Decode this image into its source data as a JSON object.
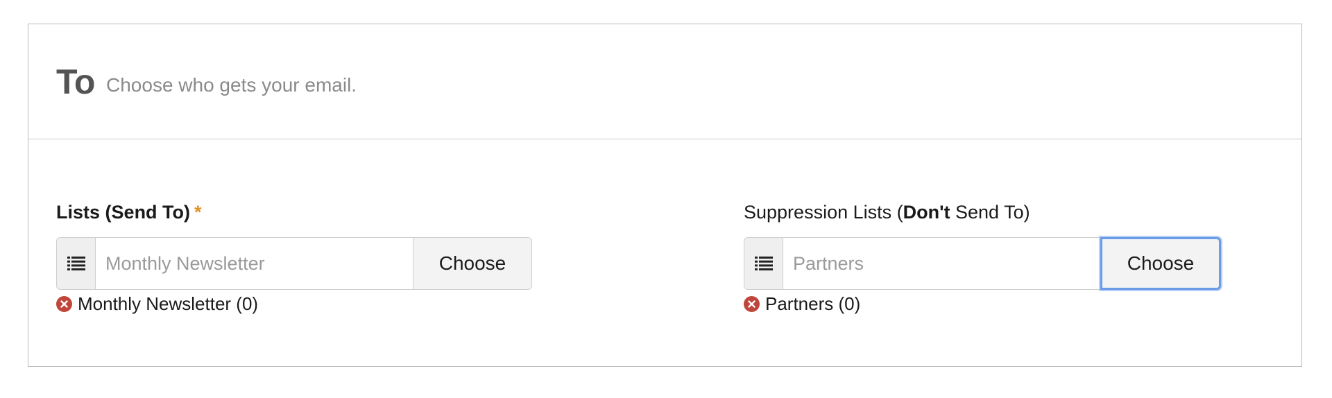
{
  "section": {
    "title": "To",
    "subtitle": "Choose who gets your email."
  },
  "lists": {
    "label_main": "Lists",
    "label_paren": "(Send To)",
    "required_marker": "*",
    "input_value": "",
    "input_placeholder": "Monthly Newsletter",
    "choose_label": "Choose",
    "icon": "list-icon",
    "selected_item": "Monthly Newsletter (0)"
  },
  "suppression": {
    "label_prefix": "Suppression Lists (",
    "label_bold": "Don't",
    "label_suffix": " Send To)",
    "input_value": "",
    "input_placeholder": "Partners",
    "choose_label": "Choose",
    "icon": "list-icon",
    "selected_item": "Partners (0)"
  },
  "colors": {
    "required": "#e0912a",
    "remove_icon": "#c0453a",
    "focus_ring": "#6b9ce8"
  }
}
